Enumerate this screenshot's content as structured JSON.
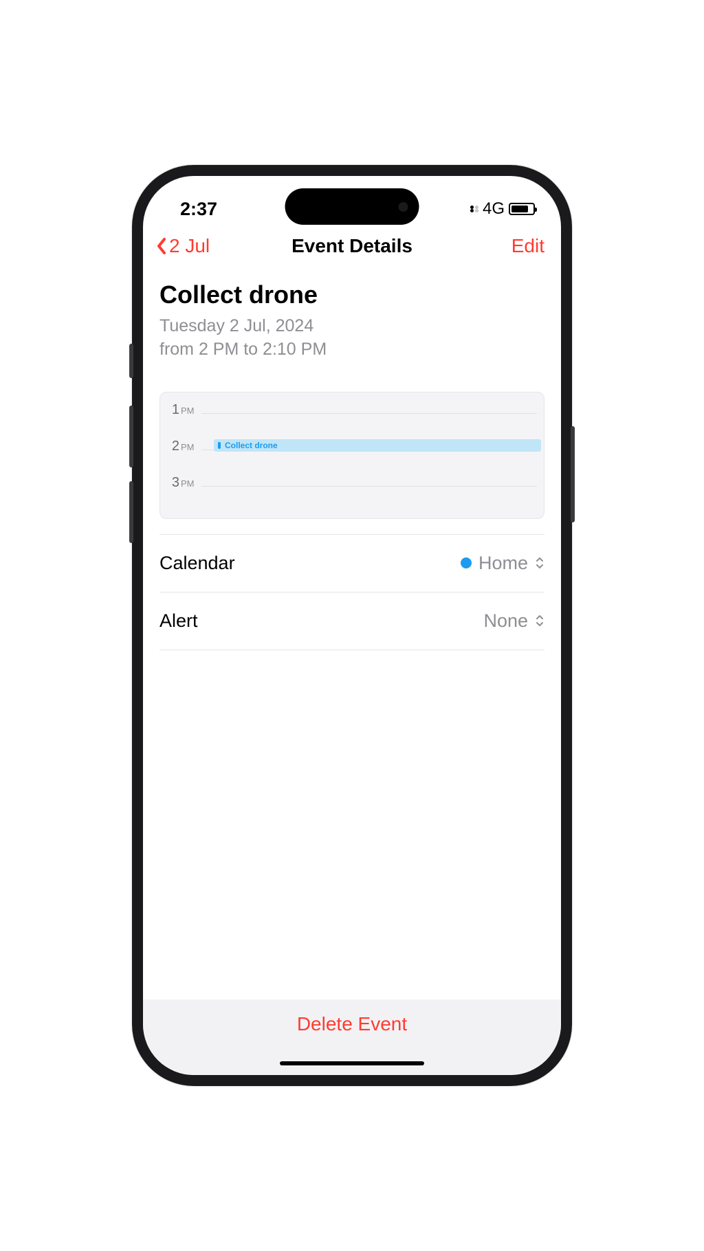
{
  "status": {
    "time": "2:37",
    "network": "4G"
  },
  "nav": {
    "back_label": "2 Jul",
    "title": "Event Details",
    "edit_label": "Edit"
  },
  "event": {
    "title": "Collect drone",
    "date_line": "Tuesday 2 Jul, 2024",
    "time_line": "from 2 PM to 2:10 PM"
  },
  "timeline": {
    "hours": [
      {
        "num": "1",
        "ampm": "PM"
      },
      {
        "num": "2",
        "ampm": "PM"
      },
      {
        "num": "3",
        "ampm": "PM"
      }
    ],
    "event_label": "Collect drone"
  },
  "rows": {
    "calendar": {
      "label": "Calendar",
      "value": "Home",
      "color": "#1d9bf0"
    },
    "alert": {
      "label": "Alert",
      "value": "None"
    }
  },
  "delete_label": "Delete Event"
}
